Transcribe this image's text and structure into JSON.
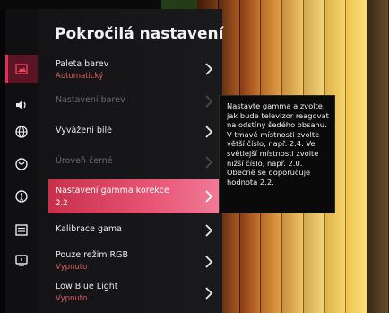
{
  "menu": {
    "title": "Pokročilá nastavení",
    "items": [
      {
        "label": "Paleta barev",
        "value": "Automatický",
        "state": "normal"
      },
      {
        "label": "Nastavení barev",
        "value": "",
        "state": "disabled"
      },
      {
        "label": "Vyvážení bílé",
        "value": "",
        "state": "normal"
      },
      {
        "label": "Úroveň černé",
        "value": "",
        "state": "disabled"
      },
      {
        "label": "Nastavení gamma korekce",
        "value": "2.2",
        "state": "selected"
      },
      {
        "label": "Kalibrace gama",
        "value": "",
        "state": "normal"
      },
      {
        "label": "Pouze režim RGB",
        "value": "Vypnuto",
        "state": "normal"
      },
      {
        "label": "Low Blue Light",
        "value": "Vypnuto",
        "state": "normal"
      }
    ]
  },
  "sidebar": {
    "icons": [
      "picture-icon",
      "sound-icon",
      "network-icon",
      "channel-icon",
      "accessibility-icon",
      "list-icon",
      "support-icon"
    ]
  },
  "tooltip": {
    "text": "Nastavte gamma a zvolte, jak bude televizor reagovat na odstíny šedého obsahu. V tmavé místnosti zvolte větší číslo, např. 2.4. Ve světlejší místnosti zvolte nižší číslo, např. 2.0. Obecně se doporučuje hodnota 2.2."
  },
  "colors": {
    "accent": "#e0305a",
    "value_text": "#d8605a",
    "panel_bg": "#161618"
  }
}
